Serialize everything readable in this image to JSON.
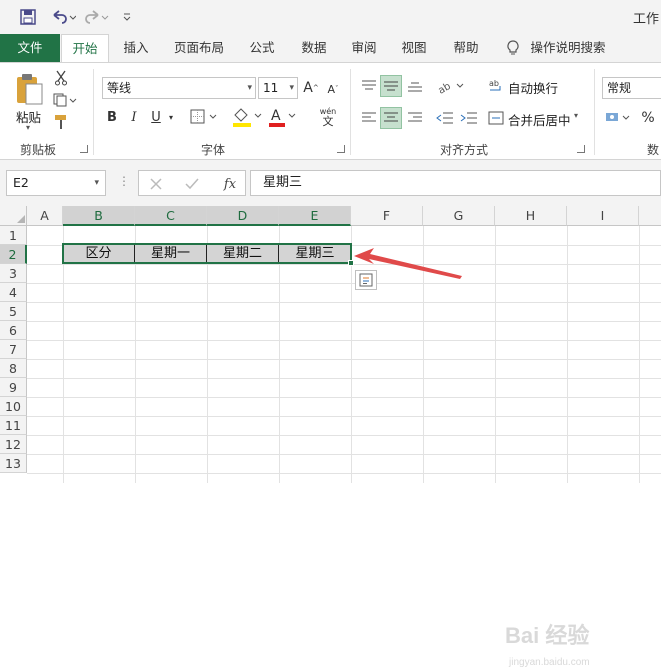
{
  "app": {
    "title_partial": "工作"
  },
  "tabs": [
    {
      "label": "文件"
    },
    {
      "label": "开始"
    },
    {
      "label": "插入"
    },
    {
      "label": "页面布局"
    },
    {
      "label": "公式"
    },
    {
      "label": "数据"
    },
    {
      "label": "审阅"
    },
    {
      "label": "视图"
    },
    {
      "label": "帮助"
    },
    {
      "label": "操作说明搜索"
    }
  ],
  "ribbon": {
    "clipboard": {
      "paste_label": "粘贴",
      "group_label": "剪贴板"
    },
    "font": {
      "font_name": "等线",
      "font_size": "11",
      "group_label": "字体",
      "bold": "B",
      "italic": "I",
      "underline": "U",
      "font_color_glyph": "A",
      "phonetic_top": "wén",
      "phonetic_bottom": "文"
    },
    "alignment": {
      "wrap_text": "自动换行",
      "merge_center": "合并后居中",
      "group_label": "对齐方式"
    },
    "number": {
      "format": "常规",
      "percent": "%",
      "group_label_partial": "数"
    }
  },
  "formula_bar": {
    "name_box": "E2",
    "fx": "fx",
    "content": "星期三"
  },
  "grid": {
    "columns": [
      "A",
      "B",
      "C",
      "D",
      "E",
      "F",
      "G",
      "H",
      "I"
    ],
    "rows": [
      "1",
      "2",
      "3",
      "4",
      "5",
      "6",
      "7",
      "8",
      "9",
      "10",
      "11",
      "12",
      "13"
    ],
    "row2": [
      "区分",
      "星期一",
      "星期二",
      "星期三"
    ]
  },
  "watermark": {
    "text": "Bai 经验",
    "sub": "jingyan.baidu.com"
  },
  "colors": {
    "excel_green": "#217346",
    "selection_fill": "#d4d4d4",
    "arrow_red": "#e04a4a"
  }
}
